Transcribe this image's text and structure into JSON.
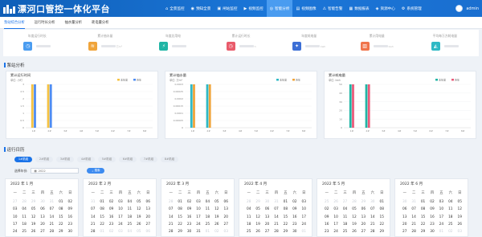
{
  "header": {
    "title": "漂河口管控一体化平台",
    "nav": [
      {
        "label": "全景监控",
        "icon": "home-icon"
      },
      {
        "label": "预知全景",
        "icon": "eye-icon"
      },
      {
        "label": "闸站监控",
        "icon": "gate-icon"
      },
      {
        "label": "视频监控",
        "icon": "video-icon"
      },
      {
        "label": "智能分析",
        "icon": "analysis-icon"
      },
      {
        "label": "视频图像",
        "icon": "image-icon"
      },
      {
        "label": "智能告警",
        "icon": "alarm-icon"
      },
      {
        "label": "数据报表",
        "icon": "report-icon"
      },
      {
        "label": "资源中心",
        "icon": "resource-icon"
      },
      {
        "label": "系统管理",
        "icon": "settings-icon"
      }
    ],
    "active_nav": 4,
    "user": "admin"
  },
  "tabs": [
    "泵站综合分析",
    "运行时长分析",
    "抽水量分析",
    "耗电量分析"
  ],
  "stats": [
    {
      "label": "年度运行时长",
      "unit": "",
      "color": "#4a9cf0",
      "icon": "clock-icon"
    },
    {
      "label": "累计抽水量",
      "unit": "万m³",
      "color": "#f0a43a",
      "icon": "water-icon"
    },
    {
      "label": "年度总用电",
      "unit": "",
      "color": "#20b5a5",
      "icon": "power-icon"
    },
    {
      "label": "累计运行时长",
      "unit": "h",
      "color": "#e95b6b",
      "icon": "clock-icon"
    },
    {
      "label": "年度耗电量",
      "unit": "kwh",
      "color": "#3d6fd6",
      "icon": "energy-icon"
    },
    {
      "label": "累计用电量",
      "unit": "kwh",
      "color": "#f0744a",
      "icon": "meter-icon"
    },
    {
      "label": "平均每万方耗电量",
      "unit": "",
      "color": "#2fb9c5",
      "icon": "avg-icon"
    }
  ],
  "section_pump": "泵站分析",
  "section_calendar": "运行日历",
  "chart_data": [
    {
      "type": "bar",
      "title": "累计运行时间",
      "ylabel": "单位: 小时",
      "ylim": [
        0,
        3
      ],
      "yticks": [
        "3",
        "2.5",
        "2",
        "1.5",
        "1",
        "0.5",
        "0"
      ],
      "categories": [
        "1#",
        "2#",
        "3#",
        "4#",
        "5#",
        "6#",
        "7#",
        "8#"
      ],
      "series": [
        {
          "name": "本年度",
          "color": "#f5c243",
          "values": [
            3,
            3,
            0,
            0,
            0,
            0,
            0,
            0
          ]
        },
        {
          "name": "历年",
          "color": "#4e8cf2",
          "values": [
            3,
            3,
            0,
            0,
            0,
            0,
            0,
            0
          ]
        }
      ]
    },
    {
      "type": "bar",
      "title": "累计抽水量",
      "ylabel": "单位: 万m³",
      "ylim": [
        0,
        0.0003
      ],
      "yticks": [
        "0.0003",
        "0.00025",
        "0.0002",
        "0.00015",
        "0.0001",
        "0.00005",
        "0"
      ],
      "categories": [
        "1#",
        "2#",
        "3#",
        "4#",
        "5#",
        "6#",
        "7#",
        "8#"
      ],
      "series": [
        {
          "name": "本年度",
          "color": "#2fb9c5",
          "values": [
            0.0003,
            0.0003,
            0,
            0,
            0,
            0,
            0,
            0
          ]
        },
        {
          "name": "历年",
          "color": "#f0a43a",
          "values": [
            0.0003,
            0.0003,
            0,
            0,
            0,
            0,
            0,
            0
          ]
        }
      ]
    },
    {
      "type": "bar",
      "title": "累计耗电量",
      "ylabel": "单位: kwh",
      "ylim": [
        0,
        50
      ],
      "yticks": [
        "50",
        "40",
        "30",
        "20",
        "10",
        "0"
      ],
      "categories": [
        "1#",
        "2#",
        "3#",
        "4#",
        "5#",
        "6#",
        "7#",
        "8#"
      ],
      "series": [
        {
          "name": "本年度",
          "color": "#20b5a5",
          "values": [
            50,
            50,
            0,
            0,
            0,
            0,
            0,
            0
          ]
        },
        {
          "name": "历年",
          "color": "#e95b7a",
          "values": [
            50,
            50,
            0,
            0,
            0,
            0,
            0,
            0
          ]
        }
      ]
    }
  ],
  "pump_toggles": [
    "1#机组",
    "2#机组",
    "3#机组",
    "4#机组",
    "5#机组",
    "6#机组",
    "7#机组",
    "8#机组"
  ],
  "filter": {
    "label": "选择年份:",
    "value": "2022",
    "button": "搜索"
  },
  "calendar": {
    "weekdays": [
      "一",
      "二",
      "三",
      "四",
      "五",
      "六",
      "日"
    ],
    "months": [
      {
        "title": "2022 年 1 月",
        "rows": [
          [
            "27",
            "28",
            "29",
            "30",
            "31",
            "01",
            "02"
          ],
          [
            "03",
            "04",
            "05",
            "06",
            "07",
            "08",
            "09"
          ],
          [
            "10",
            "11",
            "12",
            "13",
            "14",
            "15",
            "16"
          ],
          [
            "17",
            "18",
            "19",
            "20",
            "21",
            "22",
            "23"
          ],
          [
            "24",
            "25",
            "26",
            "27",
            "28",
            "29",
            "30"
          ]
        ],
        "gray_first": 5
      },
      {
        "title": "2022 年 2 月",
        "rows": [
          [
            "31",
            "01",
            "02",
            "03",
            "04",
            "05",
            "06"
          ],
          [
            "07",
            "08",
            "09",
            "10",
            "11",
            "12",
            "13"
          ],
          [
            "14",
            "15",
            "16",
            "17",
            "18",
            "19",
            "20"
          ],
          [
            "21",
            "22",
            "23",
            "24",
            "25",
            "26",
            "27"
          ],
          [
            "28",
            "01",
            "02",
            "03",
            "04",
            "05",
            "06"
          ]
        ],
        "gray_first": 1
      },
      {
        "title": "2022 年 3 月",
        "rows": [
          [
            "28",
            "01",
            "02",
            "03",
            "04",
            "05",
            "06"
          ],
          [
            "07",
            "08",
            "09",
            "10",
            "11",
            "12",
            "13"
          ],
          [
            "14",
            "15",
            "16",
            "17",
            "18",
            "19",
            "20"
          ],
          [
            "21",
            "22",
            "23",
            "24",
            "25",
            "26",
            "27"
          ],
          [
            "28",
            "29",
            "30",
            "31",
            "01",
            "02",
            "03"
          ]
        ],
        "gray_first": 1
      },
      {
        "title": "2022 年 4 月",
        "rows": [
          [
            "28",
            "29",
            "30",
            "31",
            "01",
            "02",
            "03"
          ],
          [
            "04",
            "05",
            "06",
            "07",
            "08",
            "09",
            "10"
          ],
          [
            "11",
            "12",
            "13",
            "14",
            "15",
            "16",
            "17"
          ],
          [
            "18",
            "19",
            "20",
            "21",
            "22",
            "23",
            "24"
          ],
          [
            "25",
            "26",
            "27",
            "28",
            "29",
            "30",
            "01"
          ]
        ],
        "gray_first": 4
      },
      {
        "title": "2022 年 5 月",
        "rows": [
          [
            "25",
            "26",
            "27",
            "28",
            "29",
            "30",
            "01"
          ],
          [
            "02",
            "03",
            "04",
            "05",
            "06",
            "07",
            "08"
          ],
          [
            "09",
            "10",
            "11",
            "12",
            "13",
            "14",
            "15"
          ],
          [
            "16",
            "17",
            "18",
            "19",
            "20",
            "21",
            "22"
          ],
          [
            "23",
            "24",
            "25",
            "26",
            "27",
            "28",
            "29"
          ]
        ],
        "gray_first": 6
      },
      {
        "title": "2022 年 6 月",
        "rows": [
          [
            "30",
            "31",
            "01",
            "02",
            "03",
            "04",
            "05"
          ],
          [
            "06",
            "07",
            "08",
            "09",
            "10",
            "11",
            "12"
          ],
          [
            "13",
            "14",
            "15",
            "16",
            "17",
            "18",
            "19"
          ],
          [
            "20",
            "21",
            "22",
            "23",
            "24",
            "25",
            "26"
          ],
          [
            "27",
            "28",
            "29",
            "30",
            "01",
            "02",
            "03"
          ]
        ],
        "gray_first": 2
      }
    ]
  }
}
